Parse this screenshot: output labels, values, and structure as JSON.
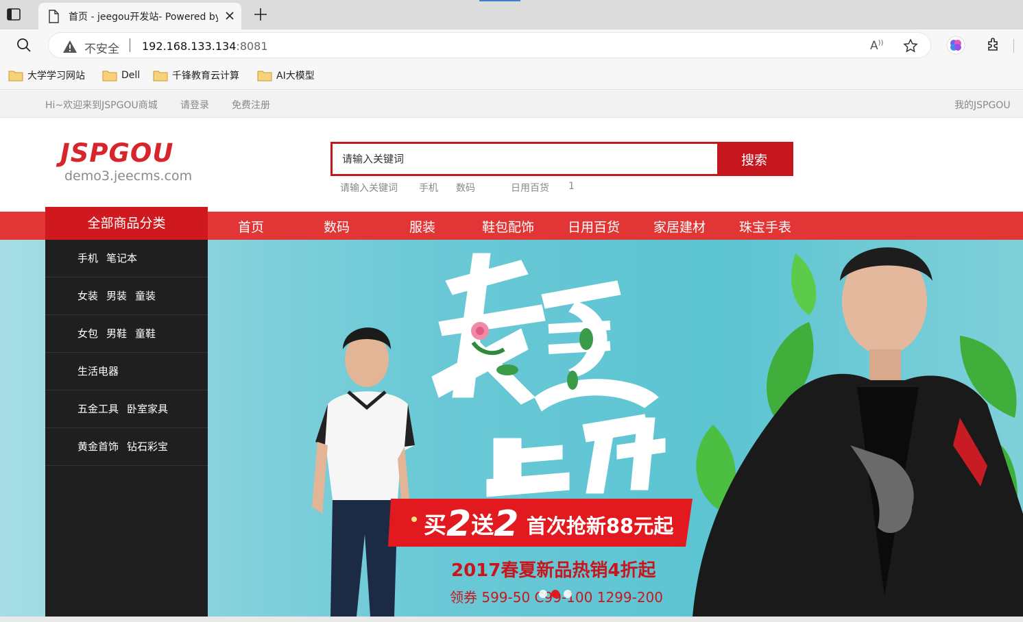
{
  "browser": {
    "tab_title": "首页 - jeegou开发站- Powered by",
    "insecure_label": "不安全",
    "url_host": "192.168.133.134",
    "url_port": ":8081",
    "read_aloud": "Aᴬ"
  },
  "bookmarks": [
    {
      "label": "大学学习网站"
    },
    {
      "label": "Dell"
    },
    {
      "label": "千锋教育云计算"
    },
    {
      "label": "AI大模型"
    }
  ],
  "topbar": {
    "welcome": "Hi~欢迎来到JSPGOU商城",
    "login": "请登录",
    "register": "免费注册",
    "my_account": "我的JSPGOU"
  },
  "logo": {
    "brand": "JSPGOU",
    "domain": "demo3.jeecms.com"
  },
  "search": {
    "placeholder": "请输入关键词",
    "button": "搜索",
    "hotwords": [
      "请输入关键词",
      "手机",
      "数码",
      "日用百货",
      "1"
    ]
  },
  "nav": {
    "all_categories": "全部商品分类",
    "items": [
      "首页",
      "数码",
      "服装",
      "鞋包配饰",
      "日用百货",
      "家居建材",
      "珠宝手表"
    ]
  },
  "categories": [
    [
      "手机",
      "笔记本"
    ],
    [
      "女装",
      "男装",
      "童装"
    ],
    [
      "女包",
      "男鞋",
      "童鞋"
    ],
    [
      "生活电器"
    ],
    [
      "五金工具",
      "卧室家具"
    ],
    [
      "黄金首饰",
      "钻石彩宝"
    ]
  ],
  "banner": {
    "headline_1": "春夏",
    "headline_2": "上新",
    "promo": "买2送2 首次抢新88元起",
    "promo_parts": [
      "买",
      "2",
      "送",
      "2",
      "首次抢新88元起"
    ],
    "sale": "2017春夏新品热销4折起",
    "coupon": "领券 599-50 C99-100 1299-200",
    "slide_count": 3,
    "active_slide": 2,
    "colors": {
      "bg": "#5cc4d2",
      "red": "#e2191e",
      "sale_red": "#c8161d"
    }
  }
}
